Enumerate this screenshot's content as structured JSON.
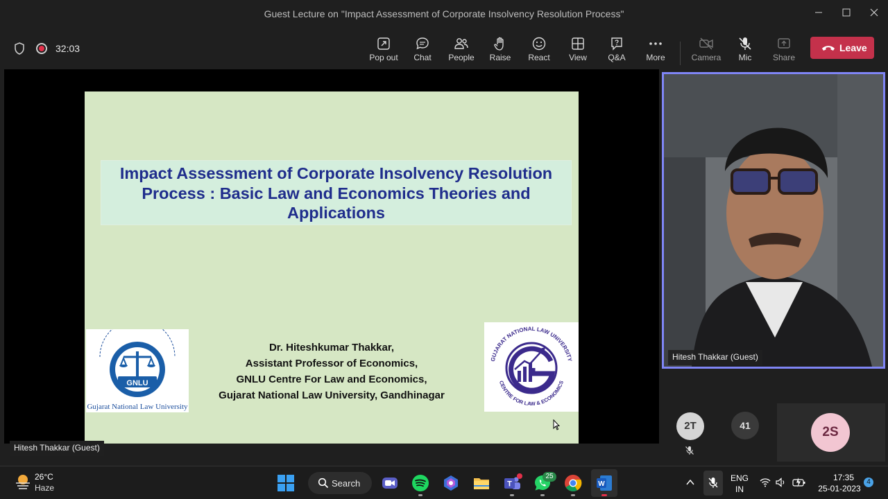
{
  "window": {
    "title": "Guest Lecture on \"Impact Assessment of Corporate Insolvency Resolution Process\""
  },
  "toolbar": {
    "timer": "32:03",
    "buttons": [
      {
        "label": "Pop out",
        "icon": "pop-out-icon"
      },
      {
        "label": "Chat",
        "icon": "chat-icon"
      },
      {
        "label": "People",
        "icon": "people-icon"
      },
      {
        "label": "Raise",
        "icon": "hand-icon"
      },
      {
        "label": "React",
        "icon": "smiley-icon"
      },
      {
        "label": "View",
        "icon": "grid-icon"
      },
      {
        "label": "Q&A",
        "icon": "qa-icon"
      },
      {
        "label": "More",
        "icon": "more-icon"
      },
      {
        "label": "Camera",
        "icon": "camera-off-icon"
      },
      {
        "label": "Mic",
        "icon": "mic-off-icon"
      },
      {
        "label": "Share",
        "icon": "share-icon"
      }
    ],
    "leave_label": "Leave",
    "leave_color": "#c4314b"
  },
  "slide": {
    "title_lines": [
      "Impact Assessment of Corporate Insolvency Resolution",
      "Process : Basic Law and Economics Theories and",
      "Applications"
    ],
    "author_lines": [
      "Dr. Hiteshkumar Thakkar,",
      "Assistant Professor of Economics,",
      "GNLU Centre For Law and Economics,",
      "Gujarat National Law University, Gandhinagar"
    ],
    "left_logo_caption": "Gujarat National Law University",
    "left_logo_acronym": "GNLU",
    "right_logo_top_text": "GUJARAT NATIONAL LAW UNIVERSITY",
    "right_logo_bottom_text": "CENTRE FOR LAW & ECONOMICS",
    "background": "#d6e7c4",
    "title_color": "#1f2d8c"
  },
  "stage": {
    "presenter_name": "Hitesh Thakkar (Guest)"
  },
  "video": {
    "name": "Hitesh Thakkar (Guest)",
    "border_color": "#7f85f5"
  },
  "participants": [
    {
      "initials": "2T"
    },
    {
      "initials": "41"
    },
    {
      "initials": "2S"
    }
  ],
  "taskbar": {
    "temperature": "26°C",
    "condition": "Haze",
    "search_label": "Search",
    "teams_badge": "",
    "whatsapp_badge": "25",
    "language_top": "ENG",
    "language_bottom": "IN",
    "time": "17:35",
    "date": "25-01-2023",
    "notification_count": "4"
  }
}
